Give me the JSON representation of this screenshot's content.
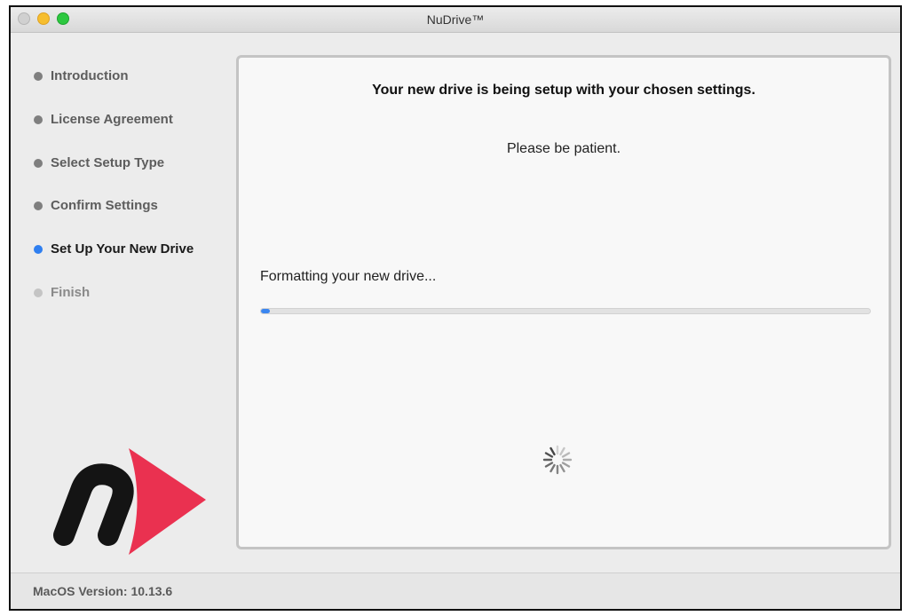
{
  "window": {
    "title": "NuDrive™"
  },
  "sidebar": {
    "steps": [
      {
        "label": "Introduction",
        "state": "done"
      },
      {
        "label": "License Agreement",
        "state": "done"
      },
      {
        "label": "Select Setup Type",
        "state": "done"
      },
      {
        "label": "Confirm Settings",
        "state": "done"
      },
      {
        "label": "Set Up Your New Drive",
        "state": "current"
      },
      {
        "label": "Finish",
        "state": "pending"
      }
    ]
  },
  "main": {
    "heading": "Your new drive is being setup with your chosen settings.",
    "subtext": "Please be patient.",
    "status": "Formatting your new drive...",
    "progress_percent": 1.5
  },
  "footer": {
    "version": "MacOS Version: 10.13.6"
  },
  "colors": {
    "accent": "#3b86f0",
    "logo_red": "#ea3150",
    "logo_black": "#141414"
  },
  "icons": {
    "logo": "nudrive-logo",
    "spinner": "loading-spinner-icon"
  }
}
